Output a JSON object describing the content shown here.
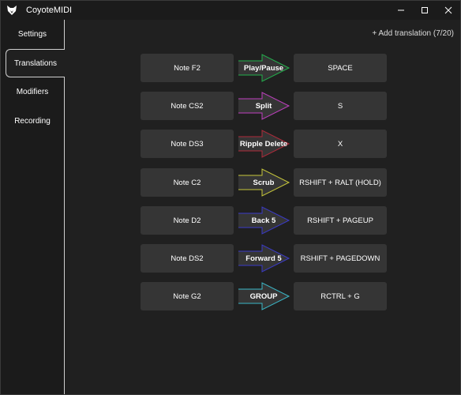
{
  "window": {
    "title": "CoyoteMIDI"
  },
  "sidebar": {
    "items": [
      {
        "label": "Settings",
        "active": false
      },
      {
        "label": "Translations",
        "active": true
      },
      {
        "label": "Modifiers",
        "active": false
      },
      {
        "label": "Recording",
        "active": false
      }
    ]
  },
  "header": {
    "add_label": "+ Add translation",
    "count_label": "(7/20)"
  },
  "translations": [
    {
      "input": "Note F2",
      "action": "Play/Pause",
      "output": "SPACE",
      "color": "#22b14c"
    },
    {
      "input": "Note CS2",
      "action": "Split",
      "output": "S",
      "color": "#c03fc0"
    },
    {
      "input": "Note DS3",
      "action": "Ripple Delete",
      "output": "X",
      "color": "#b02a3a"
    },
    {
      "input": "Note C2",
      "action": "Scrub",
      "output": "RSHIFT + RALT (HOLD)",
      "color": "#c8c83a"
    },
    {
      "input": "Note D2",
      "action": "Back 5",
      "output": "RSHIFT + PAGEUP",
      "color": "#3a3ac8"
    },
    {
      "input": "Note DS2",
      "action": "Forward 5",
      "output": "RSHIFT + PAGEDOWN",
      "color": "#3a3ac8"
    },
    {
      "input": "Note G2",
      "action": "GROUP",
      "output": "RCTRL + G",
      "color": "#3ab8c8"
    }
  ]
}
